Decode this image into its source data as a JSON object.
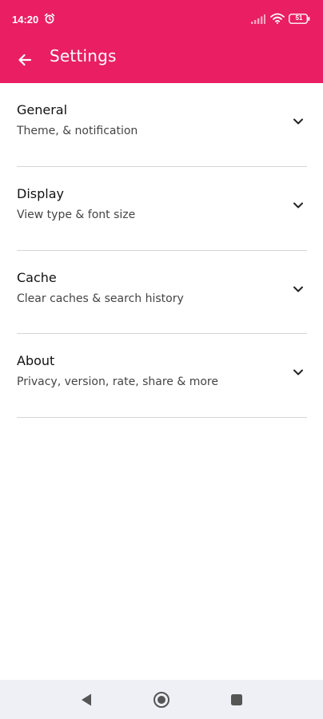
{
  "status_bar": {
    "time": "14:20",
    "battery": "51",
    "icons": [
      "alarm-icon",
      "signal-icon",
      "wifi-icon",
      "battery-icon"
    ]
  },
  "app_bar": {
    "title": "Settings",
    "back_icon": "arrow-left-icon",
    "color": "#E91E63"
  },
  "settings": {
    "items": [
      {
        "title": "General",
        "subtitle": "Theme, & notification",
        "icon": "chevron-down-icon"
      },
      {
        "title": "Display",
        "subtitle": "View type & font size",
        "icon": "chevron-down-icon"
      },
      {
        "title": "Cache",
        "subtitle": "Clear caches & search history",
        "icon": "chevron-down-icon"
      },
      {
        "title": "About",
        "subtitle": "Privacy, version, rate, share & more",
        "icon": "chevron-down-icon"
      }
    ]
  },
  "nav_bar": {
    "icons": [
      "nav-back-icon",
      "nav-home-icon",
      "nav-recents-icon"
    ]
  }
}
